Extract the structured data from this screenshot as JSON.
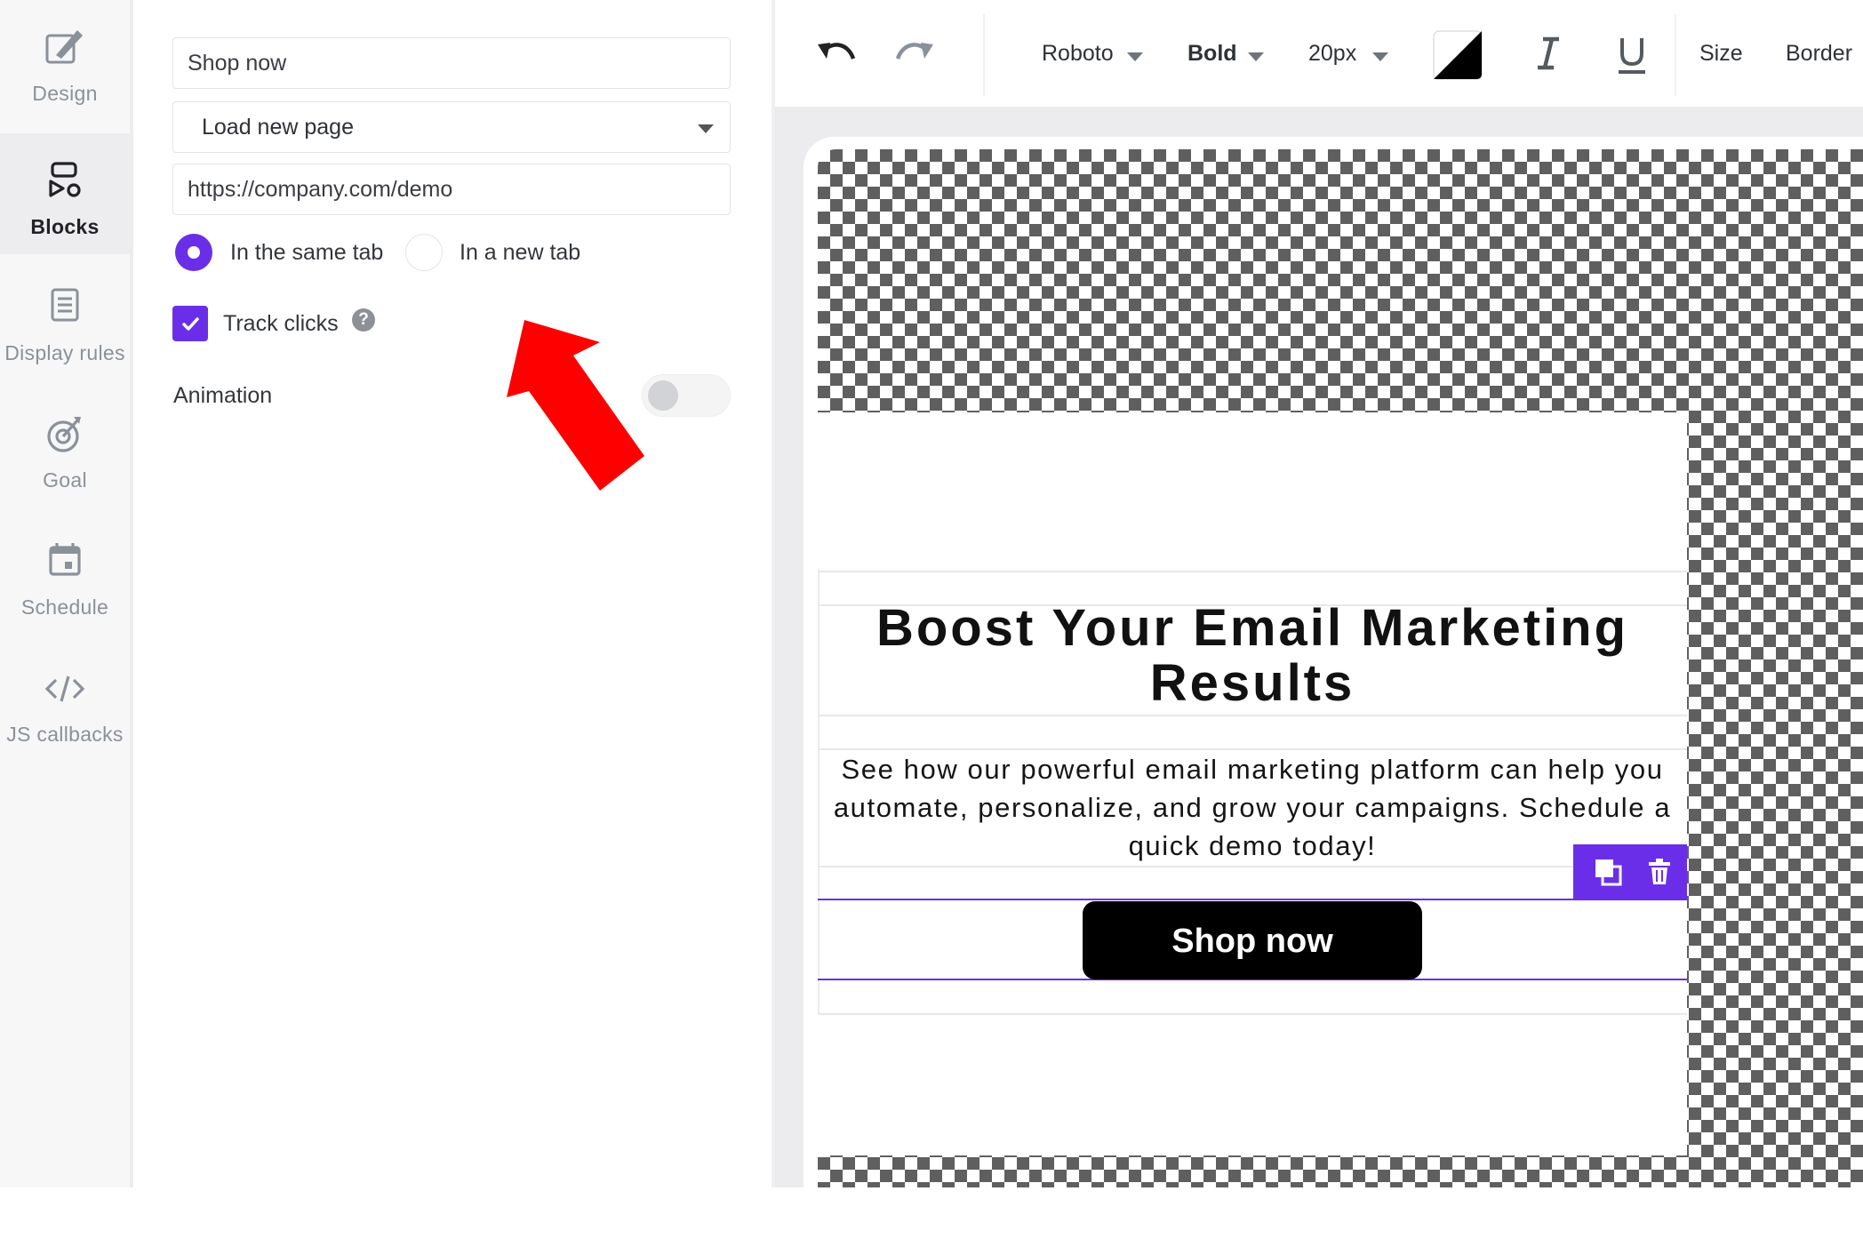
{
  "sidebar": {
    "items": [
      {
        "label": "Design",
        "icon": "design-icon",
        "active": false
      },
      {
        "label": "Blocks",
        "icon": "blocks-icon",
        "active": true
      },
      {
        "label": "Display rules",
        "icon": "display-rules-icon",
        "active": false
      },
      {
        "label": "Goal",
        "icon": "goal-icon",
        "active": false
      },
      {
        "label": "Schedule",
        "icon": "schedule-icon",
        "active": false
      },
      {
        "label": "JS callbacks",
        "icon": "code-icon",
        "active": false
      }
    ]
  },
  "settings": {
    "button_text_value": "Shop now",
    "action_select": "Load new page",
    "url_value": "https://company.com/demo",
    "open_options": [
      {
        "label": "In the same tab",
        "selected": true
      },
      {
        "label": "In a new tab",
        "selected": false
      }
    ],
    "track_clicks_label": "Track clicks",
    "track_clicks_checked": true,
    "animation_label": "Animation",
    "animation_enabled": false
  },
  "toolbar": {
    "font": "Roboto",
    "weight": "Bold",
    "size": "20px",
    "size_menu": "Size",
    "border_menu": "Border",
    "icons": [
      "undo-icon",
      "redo-icon",
      "text-color-icon",
      "italic-icon",
      "underline-icon"
    ]
  },
  "canvas": {
    "headline": "Boost Your Email Marketing Results",
    "body": "See how our powerful email marketing platform can help you automate, personalize, and grow your campaigns. Schedule a quick demo today!",
    "cta_label": "Shop now",
    "block_tools": [
      "duplicate-icon",
      "trash-icon"
    ]
  },
  "colors": {
    "accent": "#6b2ee8",
    "annotation_arrow": "#ff0000",
    "cta_bg": "#000000"
  }
}
